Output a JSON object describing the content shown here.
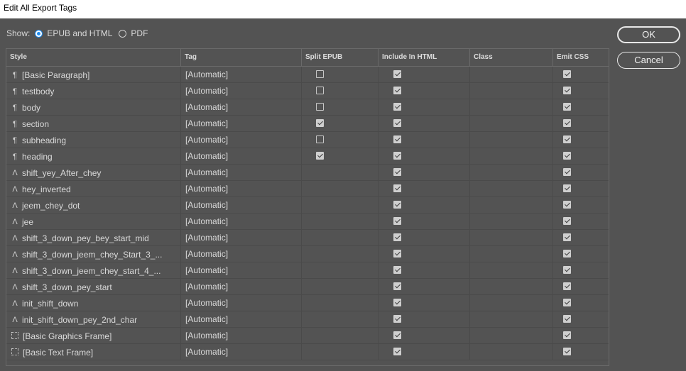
{
  "window": {
    "title": "Edit All Export Tags"
  },
  "show": {
    "label": "Show:",
    "options": [
      {
        "label": "EPUB and HTML",
        "selected": true
      },
      {
        "label": "PDF",
        "selected": false
      }
    ]
  },
  "buttons": {
    "ok": "OK",
    "cancel": "Cancel"
  },
  "table": {
    "columns": [
      "Style",
      "Tag",
      "Split EPUB",
      "Include In HTML",
      "Class",
      "Emit CSS"
    ],
    "rows": [
      {
        "icon": "paragraph-style-icon",
        "style": "[Basic Paragraph]",
        "tag": "[Automatic]",
        "split": "unchecked",
        "html": true,
        "css": true
      },
      {
        "icon": "paragraph-style-icon",
        "style": "testbody",
        "tag": "[Automatic]",
        "split": "unchecked",
        "html": true,
        "css": true
      },
      {
        "icon": "paragraph-style-icon",
        "style": "body",
        "tag": "[Automatic]",
        "split": "unchecked",
        "html": true,
        "css": true
      },
      {
        "icon": "paragraph-style-icon",
        "style": "section",
        "tag": "[Automatic]",
        "split": "checked",
        "html": true,
        "css": true
      },
      {
        "icon": "paragraph-style-icon",
        "style": "subheading",
        "tag": "[Automatic]",
        "split": "unchecked",
        "html": true,
        "css": true
      },
      {
        "icon": "paragraph-style-icon",
        "style": "heading",
        "tag": "[Automatic]",
        "split": "checked",
        "html": true,
        "css": true
      },
      {
        "icon": "character-style-icon",
        "style": "shift_yey_After_chey",
        "tag": "[Automatic]",
        "split": "none",
        "html": true,
        "css": true
      },
      {
        "icon": "character-style-icon",
        "style": "hey_inverted",
        "tag": "[Automatic]",
        "split": "none",
        "html": true,
        "css": true
      },
      {
        "icon": "character-style-icon",
        "style": "jeem_chey_dot",
        "tag": "[Automatic]",
        "split": "none",
        "html": true,
        "css": true
      },
      {
        "icon": "character-style-icon",
        "style": "jee",
        "tag": "[Automatic]",
        "split": "none",
        "html": true,
        "css": true
      },
      {
        "icon": "character-style-icon",
        "style": "shift_3_down_pey_bey_start_mid",
        "tag": "[Automatic]",
        "split": "none",
        "html": true,
        "css": true
      },
      {
        "icon": "character-style-icon",
        "style": "shift_3_down_jeem_chey_Start_3_...",
        "tag": "[Automatic]",
        "split": "none",
        "html": true,
        "css": true
      },
      {
        "icon": "character-style-icon",
        "style": "shift_3_down_jeem_chey_start_4_...",
        "tag": "[Automatic]",
        "split": "none",
        "html": true,
        "css": true
      },
      {
        "icon": "character-style-icon",
        "style": "shift_3_down_pey_start",
        "tag": "[Automatic]",
        "split": "none",
        "html": true,
        "css": true
      },
      {
        "icon": "character-style-icon",
        "style": "init_shift_down",
        "tag": "[Automatic]",
        "split": "none",
        "html": true,
        "css": true
      },
      {
        "icon": "character-style-icon",
        "style": "init_shift_down_pey_2nd_char",
        "tag": "[Automatic]",
        "split": "none",
        "html": true,
        "css": true
      },
      {
        "icon": "object-style-icon",
        "style": "[Basic Graphics Frame]",
        "tag": "[Automatic]",
        "split": "none",
        "html": true,
        "css": true
      },
      {
        "icon": "object-style-icon",
        "style": "[Basic Text Frame]",
        "tag": "[Automatic]",
        "split": "none",
        "html": true,
        "css": true
      }
    ]
  }
}
